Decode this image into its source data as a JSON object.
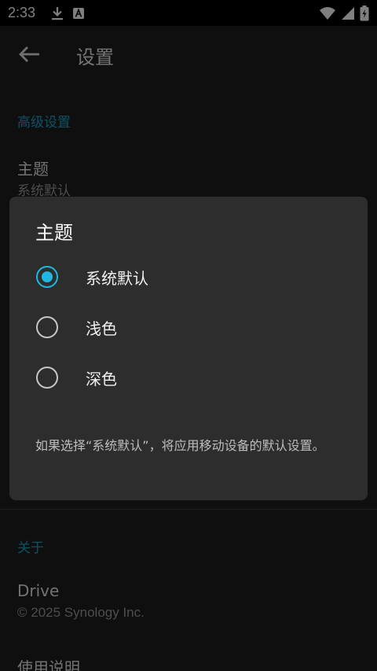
{
  "status_bar": {
    "time": "2:33",
    "icons": [
      "download-icon",
      "a-notification-icon",
      "wifi-icon",
      "cell-signal-icon",
      "battery-charging-icon"
    ]
  },
  "app_bar": {
    "back_icon": "arrow-left-icon",
    "title": "设置"
  },
  "sections": {
    "advanced": {
      "header": "高级设置",
      "theme_title": "主题",
      "theme_summary": "系统默认"
    },
    "about": {
      "header": "关于",
      "drive_title": "Drive",
      "drive_summary": "© 2025 Synology Inc.",
      "manual_title": "使用说明"
    }
  },
  "dialog": {
    "title": "主题",
    "options": [
      {
        "label": "系统默认",
        "selected": true
      },
      {
        "label": "浅色",
        "selected": false
      },
      {
        "label": "深色",
        "selected": false
      }
    ],
    "note": "如果选择“系统默认”，将应用移动设备的默认设置。"
  },
  "colors": {
    "accent": "#1fb8e0",
    "dialog_bg": "#2d2d2d",
    "page_bg": "#1f1f1f"
  }
}
